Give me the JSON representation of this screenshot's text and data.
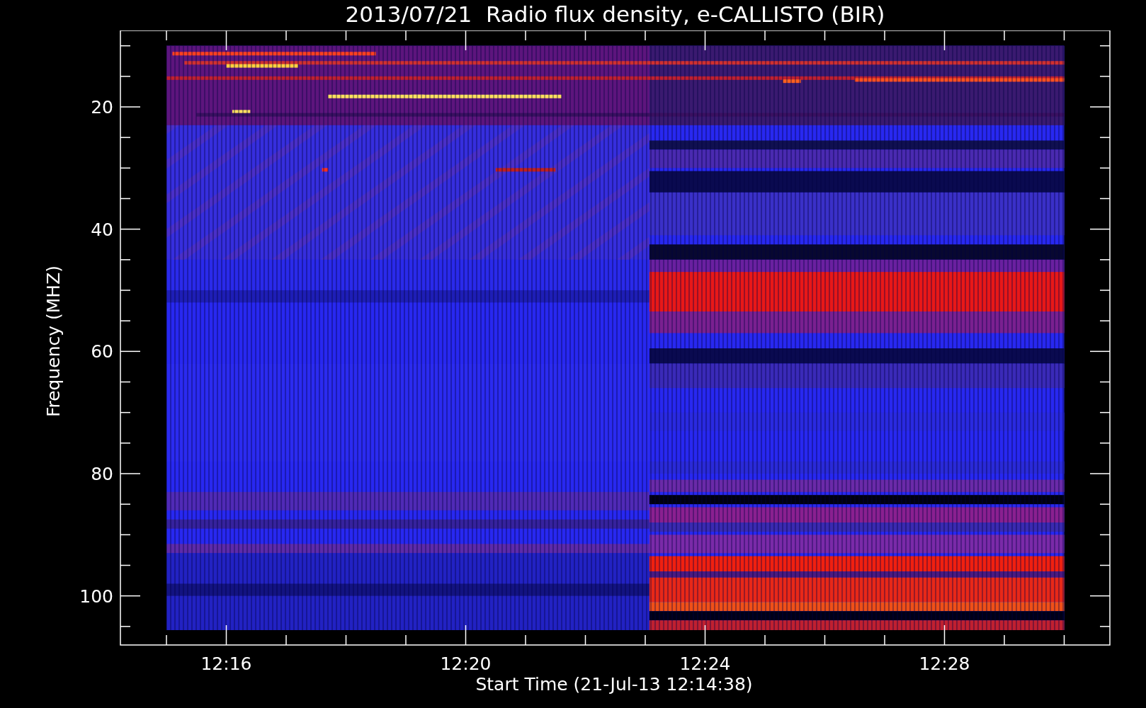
{
  "title": "2013/07/21  Radio flux density, e-CALLISTO (BIR)",
  "ylabel": "Frequency (MHZ)",
  "xlabel": "Start Time (21-Jul-13 12:14:38)",
  "yticks": [
    "20",
    "40",
    "60",
    "80",
    "100"
  ],
  "xticks": [
    "12:16",
    "12:20",
    "12:24",
    "12:28"
  ]
}
